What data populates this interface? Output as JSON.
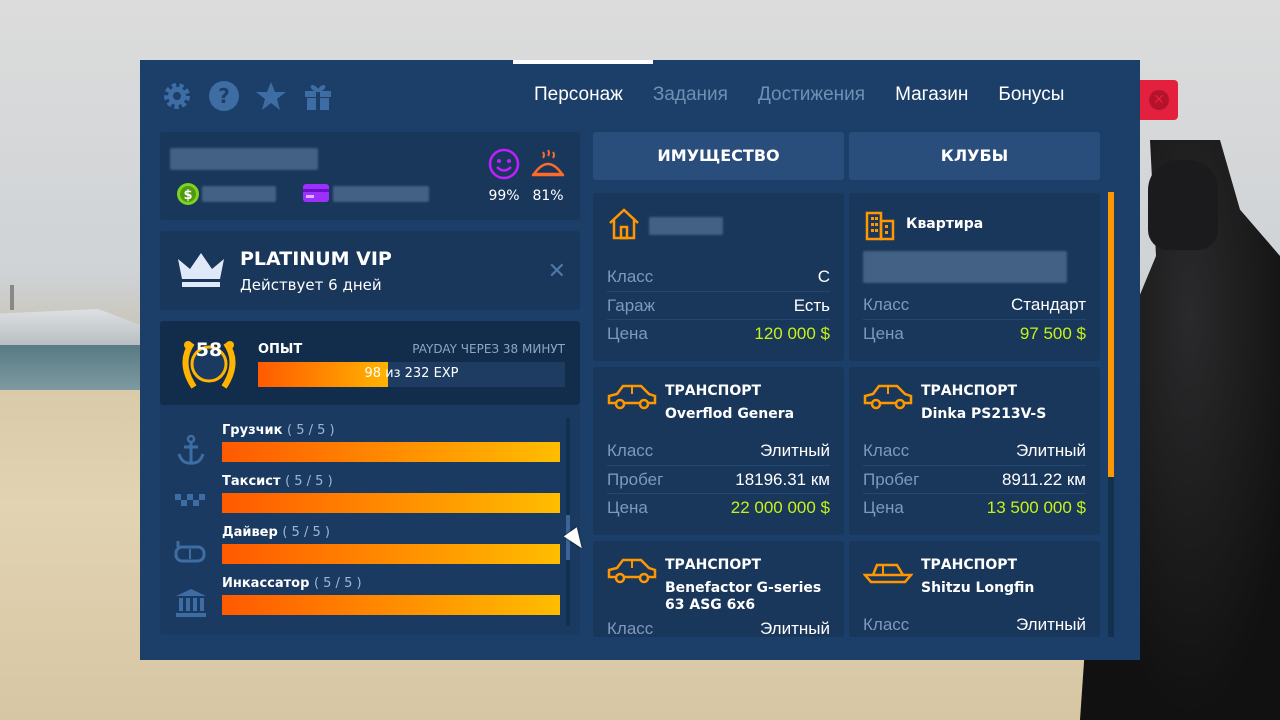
{
  "nav": {
    "tabs": [
      {
        "label": "Персонаж",
        "active": true
      },
      {
        "label": "Задания",
        "active": false
      },
      {
        "label": "Достижения",
        "active": false
      },
      {
        "label": "Магазин",
        "active": true
      },
      {
        "label": "Бонусы",
        "active": true
      }
    ],
    "icons": [
      "gear-icon",
      "help-icon",
      "star-icon",
      "gift-icon"
    ]
  },
  "profile": {
    "happiness": "99%",
    "hunger": "81%"
  },
  "vip": {
    "title": "PLATINUM VIP",
    "subtitle": "Действует 6 дней"
  },
  "experience": {
    "level": "58",
    "label": "ОПЫТ",
    "payday": "PAYDAY ЧЕРЕЗ 38 МИНУТ",
    "progress_text": "98 из 232 EXP",
    "current": 98,
    "total": 232
  },
  "skills": [
    {
      "name": "Грузчик",
      "count": "( 5 / 5 )",
      "icon": "anchor-icon",
      "progress": 1.0
    },
    {
      "name": "Таксист",
      "count": "( 5 / 5 )",
      "icon": "taxi-icon",
      "progress": 1.0
    },
    {
      "name": "Дайвер",
      "count": "( 5 / 5 )",
      "icon": "diving-mask-icon",
      "progress": 1.0
    },
    {
      "name": "Инкассатор",
      "count": "( 5 / 5 )",
      "icon": "bank-icon",
      "progress": 1.0
    }
  ],
  "right_tabs": [
    "ИМУЩЕСТВО",
    "КЛУБЫ"
  ],
  "properties": [
    {
      "type": "",
      "name": "",
      "icon": "house-icon",
      "rows": [
        {
          "k": "Класс",
          "v": "C"
        },
        {
          "k": "Гараж",
          "v": "Есть"
        },
        {
          "k": "Цена",
          "v": "120 000 $"
        }
      ]
    },
    {
      "type": "Квартира",
      "name": "",
      "icon": "building-icon",
      "rows": [
        {
          "k": "Класс",
          "v": "Стандарт"
        },
        {
          "k": "Цена",
          "v": "97 500 $"
        }
      ]
    },
    {
      "type": "ТРАНСПОРТ",
      "name": "Overflod Genera",
      "icon": "car-icon",
      "rows": [
        {
          "k": "Класс",
          "v": "Элитный"
        },
        {
          "k": "Пробег",
          "v": "18196.31 км"
        },
        {
          "k": "Цена",
          "v": "22 000 000 $"
        }
      ]
    },
    {
      "type": "ТРАНСПОРТ",
      "name": "Dinka PS213V-S",
      "icon": "car-icon",
      "rows": [
        {
          "k": "Класс",
          "v": "Элитный"
        },
        {
          "k": "Пробег",
          "v": "8911.22 км"
        },
        {
          "k": "Цена",
          "v": "13 500 000 $"
        }
      ]
    },
    {
      "type": "ТРАНСПОРТ",
      "name": "Benefactor G-series 63 ASG 6x6",
      "icon": "car-icon",
      "rows": [
        {
          "k": "Класс",
          "v": "Элитный"
        }
      ]
    },
    {
      "type": "ТРАНСПОРТ",
      "name": "Shitzu Longfin",
      "icon": "boat-icon",
      "rows": [
        {
          "k": "Класс",
          "v": "Элитный"
        }
      ]
    }
  ],
  "colors": {
    "accent": "#ff9800",
    "price": "#c6f218",
    "panel": "#1c3f69",
    "close": "#e3213e"
  }
}
